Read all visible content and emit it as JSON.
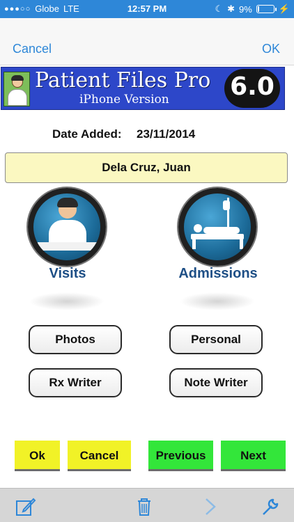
{
  "status_bar": {
    "signal": "●●●○○",
    "carrier": "Globe",
    "network": "LTE",
    "time": "12:57 PM",
    "moon": "☾",
    "bluetooth": "✱",
    "battery_percent": "9%",
    "battery_level": 0.09,
    "charging": "⚡"
  },
  "nav": {
    "cancel_label": "Cancel",
    "ok_label": "OK"
  },
  "banner": {
    "title": "Patient Files Pro",
    "subtitle": "iPhone Version",
    "version": "6.0"
  },
  "record": {
    "date_label": "Date Added:",
    "date_value": "23/11/2014",
    "patient_name": "Dela Cruz, Juan"
  },
  "icons": {
    "visits_label": "Visits",
    "admissions_label": "Admissions"
  },
  "buttons": {
    "photos": "Photos",
    "personal": "Personal",
    "rx_writer": "Rx Writer",
    "note_writer": "Note Writer"
  },
  "bottom": {
    "ok": "Ok",
    "cancel": "Cancel",
    "previous": "Previous",
    "next": "Next"
  },
  "colors": {
    "accent": "#2e87d8",
    "yellow_button": "#f1f227",
    "green_button": "#33e63a",
    "patient_box": "#fbf8c1"
  },
  "toolbar": {
    "icons": [
      "edit-icon",
      "trash-icon",
      "forward-icon",
      "wrench-icon"
    ]
  }
}
